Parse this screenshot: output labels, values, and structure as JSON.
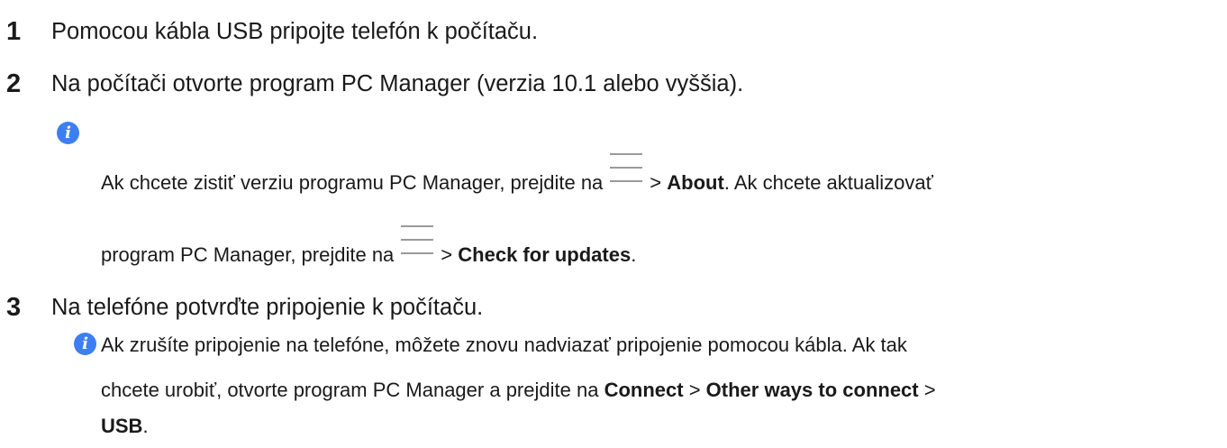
{
  "steps": [
    {
      "number": "1",
      "text": "Pomocou kábla USB pripojte telefón k počítaču."
    },
    {
      "number": "2",
      "text": "Na počítači otvorte program PC Manager (verzia 10.1 alebo vyššia)."
    },
    {
      "number": "3",
      "text": "Na telefóne potvrďte pripojenie k počítaču."
    }
  ],
  "note1": {
    "line1_before": "Ak chcete zistiť verziu programu PC Manager, prejdite na",
    "gt1": ">",
    "about": "About",
    "line1_after": ". Ak chcete aktualizovať",
    "line2_before": "program PC Manager, prejdite na",
    "gt2": ">",
    "check_updates": "Check for updates",
    "line2_after": "."
  },
  "note2": {
    "line1": "Ak zrušíte pripojenie na telefóne, môžete znovu nadviazať pripojenie pomocou kábla. Ak tak",
    "line2_before": "chcete urobiť, otvorte program PC Manager a prejdite na",
    "connect": "Connect",
    "gt1": ">",
    "other_ways": "Other ways to connect",
    "gt2": ">",
    "usb": "USB",
    "end": "."
  },
  "icons": {
    "info": "info-icon",
    "menu": "menu-icon",
    "info_glyph": "i",
    "accent_color": "#3d7ff2"
  }
}
